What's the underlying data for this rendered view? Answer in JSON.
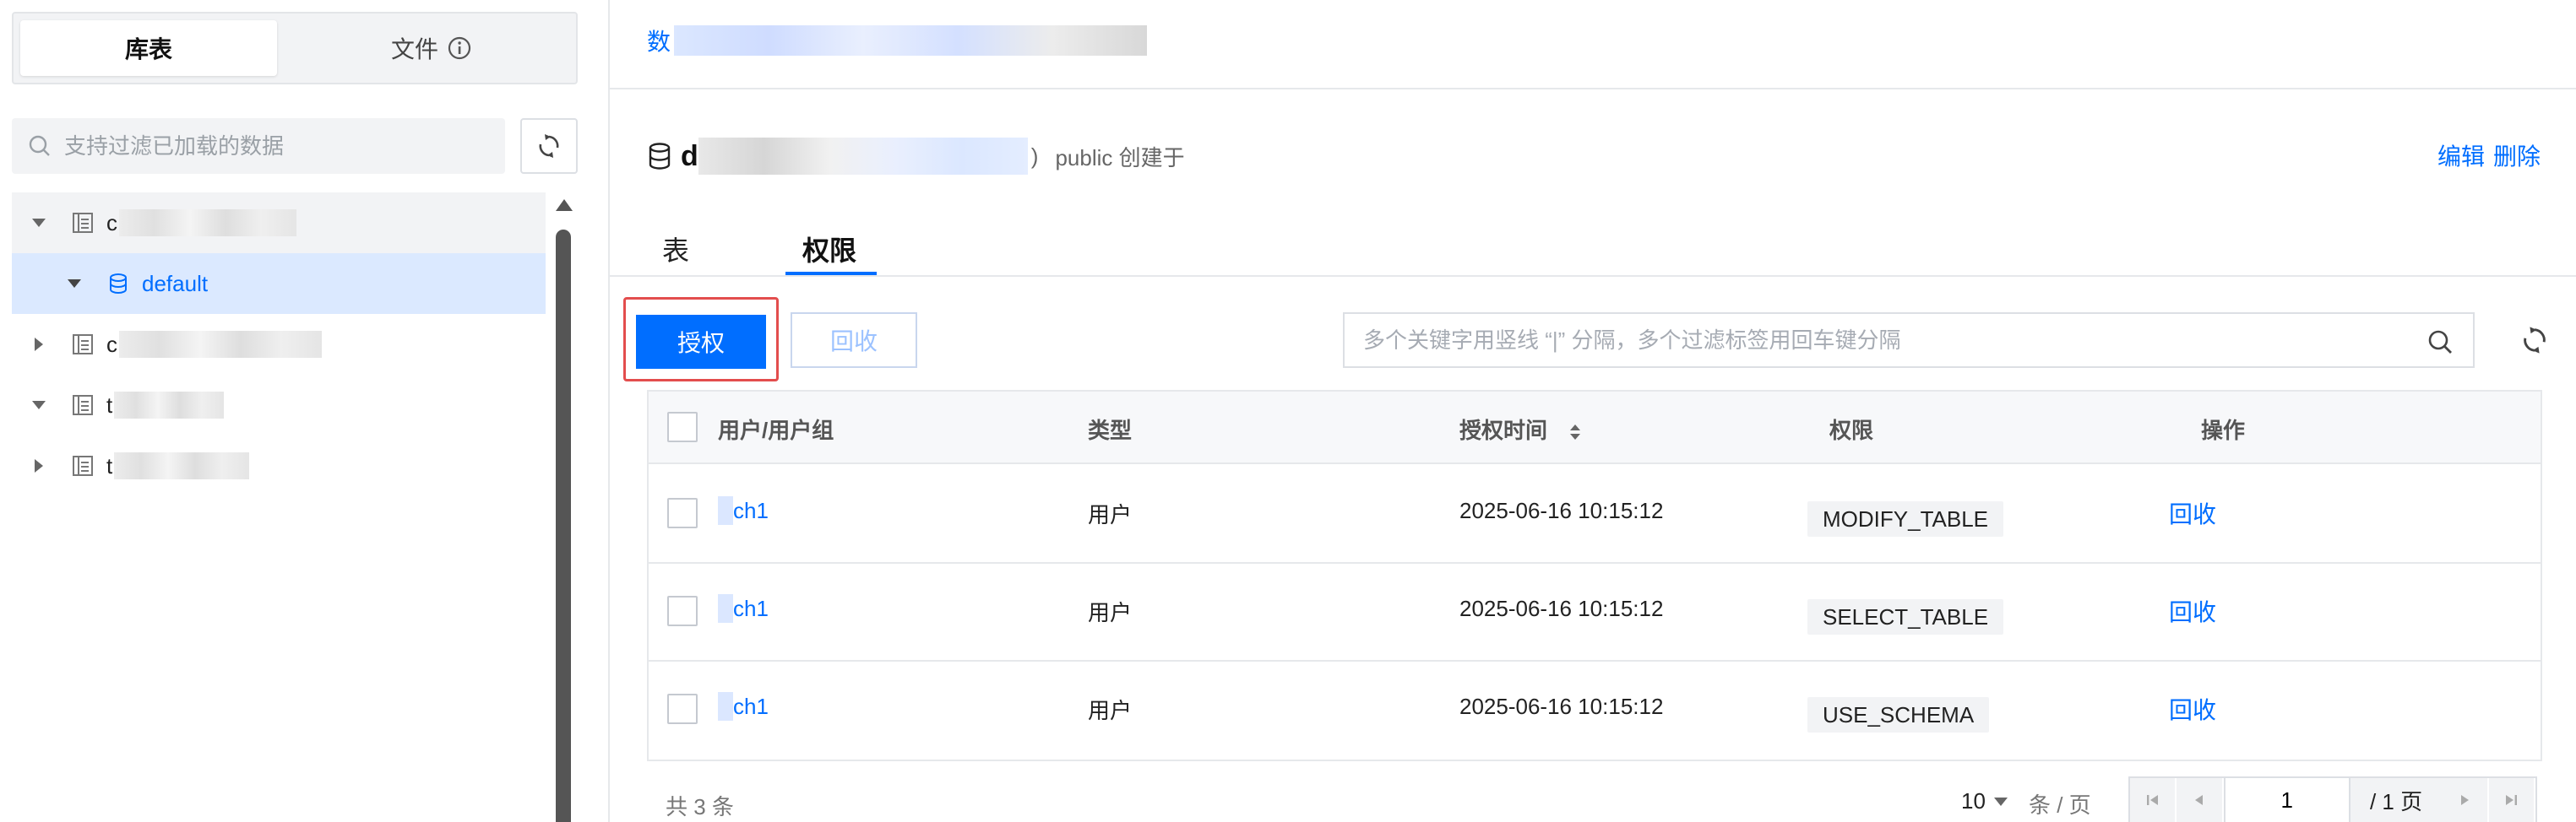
{
  "sidebar": {
    "tabs": [
      {
        "label": "库表",
        "active": true
      },
      {
        "label": "文件",
        "active": false
      }
    ],
    "search": {
      "placeholder": "支持过滤已加载的数据",
      "value": ""
    },
    "tree": [
      {
        "label": "c",
        "level": 0,
        "expanded": true
      },
      {
        "label": "default",
        "level": 1,
        "expanded": true,
        "selected": true
      },
      {
        "label": "c",
        "level": 0,
        "expanded": false
      },
      {
        "label": "t",
        "level": 0,
        "expanded": true
      },
      {
        "label": "t",
        "level": 0,
        "expanded": false
      }
    ]
  },
  "breadcrumb": {
    "text": "数"
  },
  "database": {
    "name": "d",
    "paren": ")",
    "meta": "public 创建于",
    "edit_label": "编辑",
    "delete_label": "删除"
  },
  "tabs": [
    {
      "label": "表",
      "active": false
    },
    {
      "label": "权限",
      "active": true
    }
  ],
  "toolbar": {
    "grant_label": "授权",
    "revoke_label": "回收",
    "filter_placeholder": "多个关键字用竖线 “|” 分隔，多个过滤标签用回车键分隔"
  },
  "table": {
    "columns": [
      "用户/用户组",
      "类型",
      "授权时间",
      "权限",
      "操作"
    ],
    "rows": [
      {
        "user": "ch1",
        "type": "用户",
        "time": "2025-06-16 10:15:12",
        "permission": "MODIFY_TABLE",
        "action": "回收"
      },
      {
        "user": "ch1",
        "type": "用户",
        "time": "2025-06-16 10:15:12",
        "permission": "SELECT_TABLE",
        "action": "回收"
      },
      {
        "user": "ch1",
        "type": "用户",
        "time": "2025-06-16 10:15:12",
        "permission": "USE_SCHEMA",
        "action": "回收"
      }
    ]
  },
  "pagination": {
    "total_text": "共 3 条",
    "page_size": "10",
    "page_unit": "条 / 页",
    "current_page": "1",
    "total_pages_text": "/ 1 页"
  },
  "colors": {
    "primary": "#006eff",
    "highlight_border": "#e34d4d",
    "selected_bg": "#dbe9ff"
  }
}
